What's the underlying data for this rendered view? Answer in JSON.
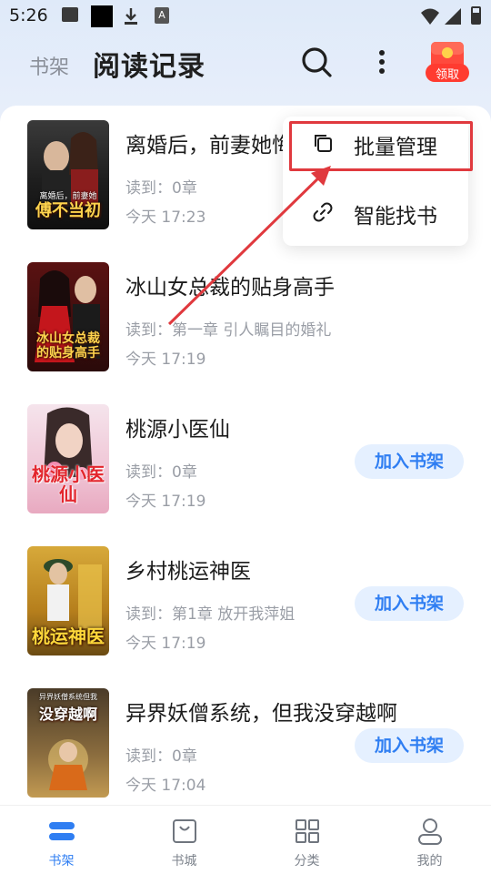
{
  "status_bar": {
    "time": "5:26"
  },
  "header": {
    "tab_shelf": "书架",
    "tab_history": "阅读记录",
    "redpack_label": "领取"
  },
  "books": [
    {
      "title": "离婚后，前妻她悔不当初",
      "progress": "读到：0章",
      "time": "今天 17:23",
      "cover_text": "傅不当初",
      "cover_top": "离婚后，前妻她",
      "cover_color": "#2a2a2a",
      "add_label": ""
    },
    {
      "title": "冰山女总裁的贴身高手",
      "progress": "读到：第一章 引人瞩目的婚礼",
      "time": "今天 17:19",
      "cover_text": "冰山女总裁的贴身高手",
      "cover_top": "",
      "cover_color": "#7a1a1a",
      "add_label": ""
    },
    {
      "title": "桃源小医仙",
      "progress": "读到：0章",
      "time": "今天 17:19",
      "cover_text": "桃源小医仙",
      "cover_top": "",
      "cover_color": "#f3c9d8",
      "add_label": "加入书架"
    },
    {
      "title": "乡村桃运神医",
      "progress": "读到：第1章 放开我萍姐",
      "time": "今天 17:19",
      "cover_text": "桃运神医",
      "cover_top": "",
      "cover_color": "#b58a2a",
      "add_label": "加入书架"
    },
    {
      "title": "异界妖僧系统，但我没穿越啊",
      "progress": "读到：0章",
      "time": "今天 17:04",
      "cover_text": "没穿越啊",
      "cover_top": "异界妖僧系统但我",
      "cover_color": "#6b5a3a",
      "add_label": "加入书架"
    }
  ],
  "popup": {
    "batch_manage": "批量管理",
    "smart_find": "智能找书"
  },
  "bottom_nav": [
    {
      "label": "书架",
      "active": true
    },
    {
      "label": "书城",
      "active": false
    },
    {
      "label": "分类",
      "active": false
    },
    {
      "label": "我的",
      "active": false
    }
  ],
  "colors": {
    "accent": "#2f7ef2",
    "highlight": "#e0393e"
  }
}
